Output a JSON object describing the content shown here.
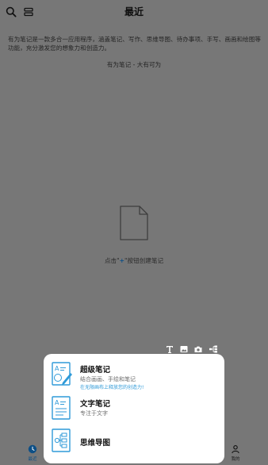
{
  "header": {
    "title": "最近",
    "search_icon": "search-icon",
    "layout_icon": "layout-icon"
  },
  "intro": {
    "text": "有为笔记是一款多合一应用程序，涵盖笔记、写作、思维导图、待办事项、手写、画画和绘图等功能，充分激发您的想象力和创造力。",
    "slogan": "有为笔记 - 大有可为"
  },
  "empty_state": {
    "icon": "empty-document-icon",
    "hint_prefix": "点击\"",
    "hint_plus": "+",
    "hint_suffix": "\"按钮创建笔记"
  },
  "quick_tools": [
    {
      "icon": "text-icon"
    },
    {
      "icon": "image-icon"
    },
    {
      "icon": "camera-icon"
    },
    {
      "icon": "mindmap-icon"
    }
  ],
  "popup": {
    "options": [
      {
        "title": "超级笔记",
        "subtitle": "结合画画、手绘和笔记",
        "note": "在无限画布上释放您的创造力!",
        "icon": "super-note-icon"
      },
      {
        "title": "文字笔记",
        "subtitle": "专注于文字",
        "icon": "text-note-icon"
      },
      {
        "title": "思维导图",
        "icon": "mindmap-icon"
      }
    ]
  },
  "bottom_nav": {
    "items": [
      {
        "label": "最近",
        "icon": "clock-icon",
        "active": true
      },
      {
        "label": "我的",
        "icon": "person-icon",
        "active": false
      }
    ]
  },
  "colors": {
    "overlay_bg": "#777777",
    "accent": "#0d4f86",
    "icon_blue": "#2f9ad8",
    "popup_bg": "#ffffff"
  }
}
